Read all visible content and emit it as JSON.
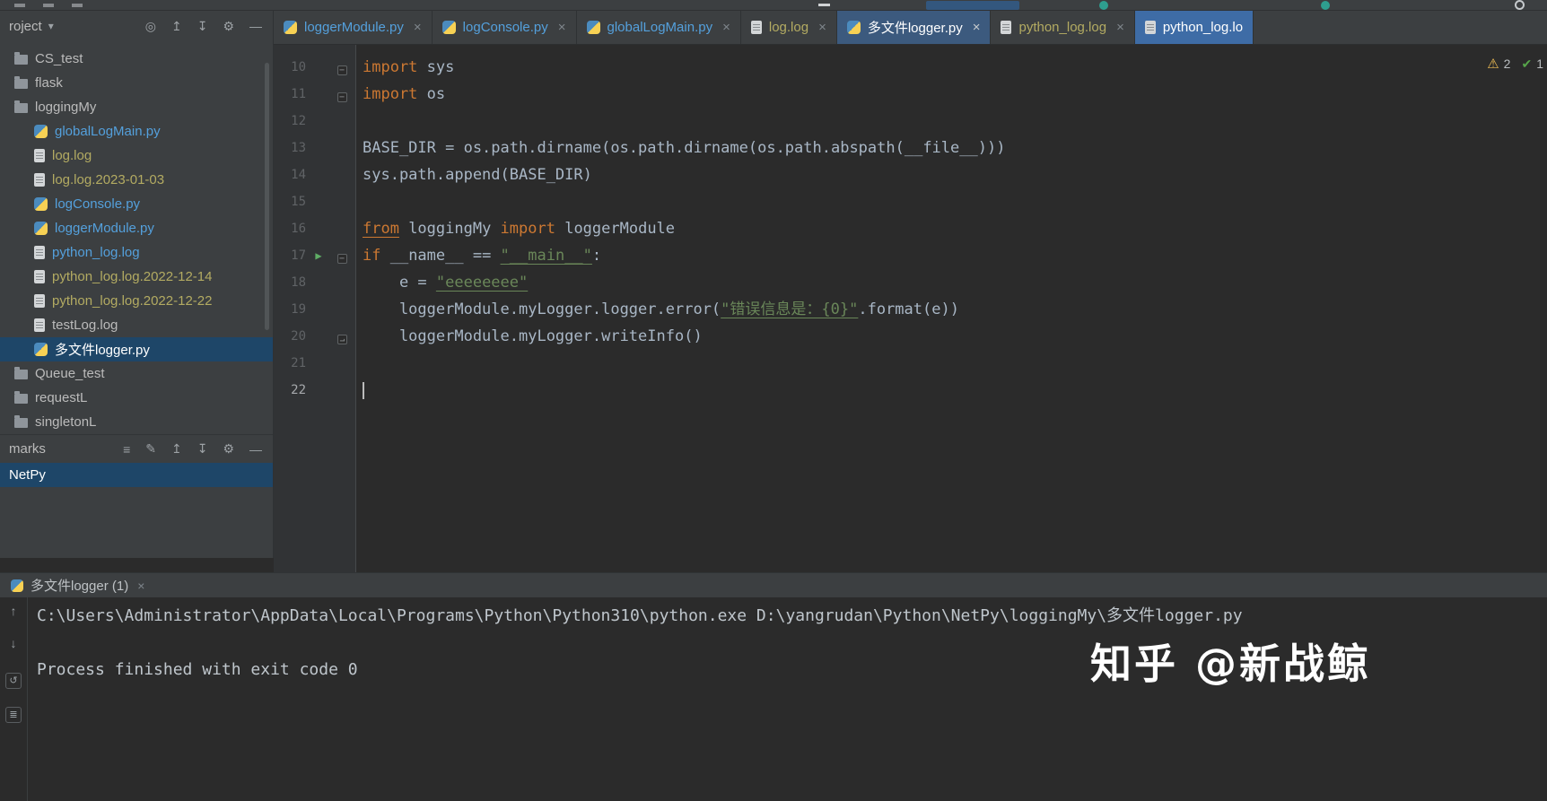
{
  "titlebar": {
    "icons": [
      {
        "name": "menu-icon",
        "cls": "sq1"
      },
      {
        "name": "menu-icon",
        "cls": "sq2"
      },
      {
        "name": "menu-icon",
        "cls": "sq3"
      },
      {
        "name": "minimize-icon",
        "cls": "dash"
      },
      {
        "name": "run-config-selector",
        "cls": "pill"
      },
      {
        "name": "service-status-icon",
        "cls": "dot1"
      },
      {
        "name": "notification-icon",
        "cls": "dot2"
      },
      {
        "name": "settings-ring-icon",
        "cls": "ring"
      }
    ]
  },
  "project": {
    "header_title": "roject",
    "header_chevron": "▾",
    "header_icons": [
      {
        "name": "locate-icon",
        "glyph": "◎"
      },
      {
        "name": "expand-all-icon",
        "glyph": "↥"
      },
      {
        "name": "collapse-all-icon",
        "glyph": "↧"
      },
      {
        "name": "settings-icon",
        "glyph": "⚙"
      },
      {
        "name": "hide-panel-icon",
        "glyph": "—"
      }
    ],
    "items": [
      {
        "label": "CS_test",
        "type": "folder",
        "indent": 0,
        "color": "default"
      },
      {
        "label": "flask",
        "type": "folder",
        "indent": 0,
        "color": "default"
      },
      {
        "label": "loggingMy",
        "type": "folder",
        "indent": 0,
        "color": "default"
      },
      {
        "label": "globalLogMain.py",
        "type": "python",
        "indent": 1,
        "color": "blue"
      },
      {
        "label": "log.log",
        "type": "log",
        "indent": 1,
        "color": "olive"
      },
      {
        "label": "log.log.2023-01-03",
        "type": "log",
        "indent": 1,
        "color": "olive"
      },
      {
        "label": "logConsole.py",
        "type": "python",
        "indent": 1,
        "color": "blue"
      },
      {
        "label": "loggerModule.py",
        "type": "python",
        "indent": 1,
        "color": "blue"
      },
      {
        "label": "python_log.log",
        "type": "log",
        "indent": 1,
        "color": "blue"
      },
      {
        "label": "python_log.log.2022-12-14",
        "type": "log",
        "indent": 1,
        "color": "olive"
      },
      {
        "label": "python_log.log.2022-12-22",
        "type": "log",
        "indent": 1,
        "color": "olive"
      },
      {
        "label": "testLog.log",
        "type": "log",
        "indent": 1,
        "color": "default"
      },
      {
        "label": "多文件logger.py",
        "type": "python",
        "indent": 1,
        "color": "white",
        "selected": true
      },
      {
        "label": "Queue_test",
        "type": "folder",
        "indent": 0,
        "color": "default"
      },
      {
        "label": "requestL",
        "type": "folder",
        "indent": 0,
        "color": "default"
      },
      {
        "label": "singletonL",
        "type": "folder",
        "indent": 0,
        "color": "default"
      }
    ]
  },
  "bookmarks": {
    "header_title": "marks",
    "header_icons": [
      {
        "name": "list-icon",
        "glyph": "≡"
      },
      {
        "name": "edit-icon",
        "glyph": "✎"
      },
      {
        "name": "expand-all-icon",
        "glyph": "↥"
      },
      {
        "name": "collapse-all-icon",
        "glyph": "↧"
      },
      {
        "name": "settings-icon",
        "glyph": "⚙"
      },
      {
        "name": "hide-panel-icon",
        "glyph": "—"
      }
    ],
    "items": [
      {
        "label": "NetPy",
        "selected": true
      }
    ]
  },
  "tabs": [
    {
      "label": "loggerModule.py",
      "icon": "python",
      "color": "blue",
      "close": "×"
    },
    {
      "label": "logConsole.py",
      "icon": "python",
      "color": "blue",
      "close": "×"
    },
    {
      "label": "globalLogMain.py",
      "icon": "python",
      "color": "blue",
      "close": "×"
    },
    {
      "label": "log.log",
      "icon": "file",
      "color": "olive",
      "close": "×"
    },
    {
      "label": "多文件logger.py",
      "icon": "python",
      "color": "white",
      "active": true,
      "close": "×"
    },
    {
      "label": "python_log.log",
      "icon": "file",
      "color": "olive",
      "close": "×"
    },
    {
      "label": "python_log.lo",
      "icon": "file",
      "color": "white",
      "highlight": true
    }
  ],
  "editor": {
    "run_glyph": "▶",
    "fold_glyphs": {
      "minus": "−",
      "end": "⌐"
    },
    "indicators": {
      "warning_glyph": "⚠",
      "warnings": "2",
      "ok_glyph": "✔",
      "ok": "1"
    },
    "lines": [
      {
        "num": "10",
        "fold": "minus",
        "segments": [
          {
            "t": "import",
            "c": "kw"
          },
          {
            "t": " sys",
            "c": "tx"
          }
        ]
      },
      {
        "num": "11",
        "fold": "minus",
        "segments": [
          {
            "t": "import",
            "c": "kw"
          },
          {
            "t": " os",
            "c": "tx"
          }
        ]
      },
      {
        "num": "12",
        "segments": []
      },
      {
        "num": "13",
        "segments": [
          {
            "t": "BASE_DIR = os.path.dirname(os.path.dirname(os.path.abspath(__file__)))",
            "c": "tx"
          }
        ]
      },
      {
        "num": "14",
        "segments": [
          {
            "t": "sys.path.append(BASE_DIR)",
            "c": "tx"
          }
        ]
      },
      {
        "num": "15",
        "segments": []
      },
      {
        "num": "16",
        "segments": [
          {
            "t": "from",
            "c": "kw und"
          },
          {
            "t": " loggingMy ",
            "c": "tx"
          },
          {
            "t": "import",
            "c": "kw"
          },
          {
            "t": " loggerModule",
            "c": "tx"
          }
        ]
      },
      {
        "num": "17",
        "run": true,
        "fold": "minus",
        "segments": [
          {
            "t": "if",
            "c": "kw"
          },
          {
            "t": " __name__ == ",
            "c": "tx"
          },
          {
            "t": "\"__main__\"",
            "c": "st und"
          },
          {
            "t": ":",
            "c": "tx"
          }
        ]
      },
      {
        "num": "18",
        "segments": [
          {
            "t": "    e = ",
            "c": "tx"
          },
          {
            "t": "\"eeeeeeee\"",
            "c": "st und"
          }
        ]
      },
      {
        "num": "19",
        "segments": [
          {
            "t": "    loggerModule.myLogger.logger.error(",
            "c": "tx"
          },
          {
            "t": "\"错误信息是：{0}\"",
            "c": "st und"
          },
          {
            "t": ".format(e))",
            "c": "tx"
          }
        ]
      },
      {
        "num": "20",
        "fold": "end",
        "segments": [
          {
            "t": "    loggerModule.myLogger.writeInfo()",
            "c": "tx"
          }
        ]
      },
      {
        "num": "21",
        "segments": []
      },
      {
        "num": "22",
        "current": true,
        "segments": []
      }
    ]
  },
  "console": {
    "tab_label": "多文件logger (1)",
    "tab_close": "×",
    "gutter_icons": [
      {
        "name": "scroll-to-top-icon",
        "glyph": "↑",
        "boxed": false
      },
      {
        "name": "scroll-to-bottom-icon",
        "glyph": "↓",
        "boxed": false
      },
      {
        "name": "rerun-icon",
        "glyph": "↺",
        "boxed": true
      },
      {
        "name": "soft-wrap-icon",
        "glyph": "≣",
        "boxed": true
      }
    ],
    "lines": [
      "C:\\Users\\Administrator\\AppData\\Local\\Programs\\Python\\Python310\\python.exe D:\\yangrudan\\Python\\NetPy\\loggingMy\\多文件logger.py",
      "",
      "Process finished with exit code 0"
    ]
  },
  "watermark": {
    "text": "知乎 @新战鲸"
  }
}
